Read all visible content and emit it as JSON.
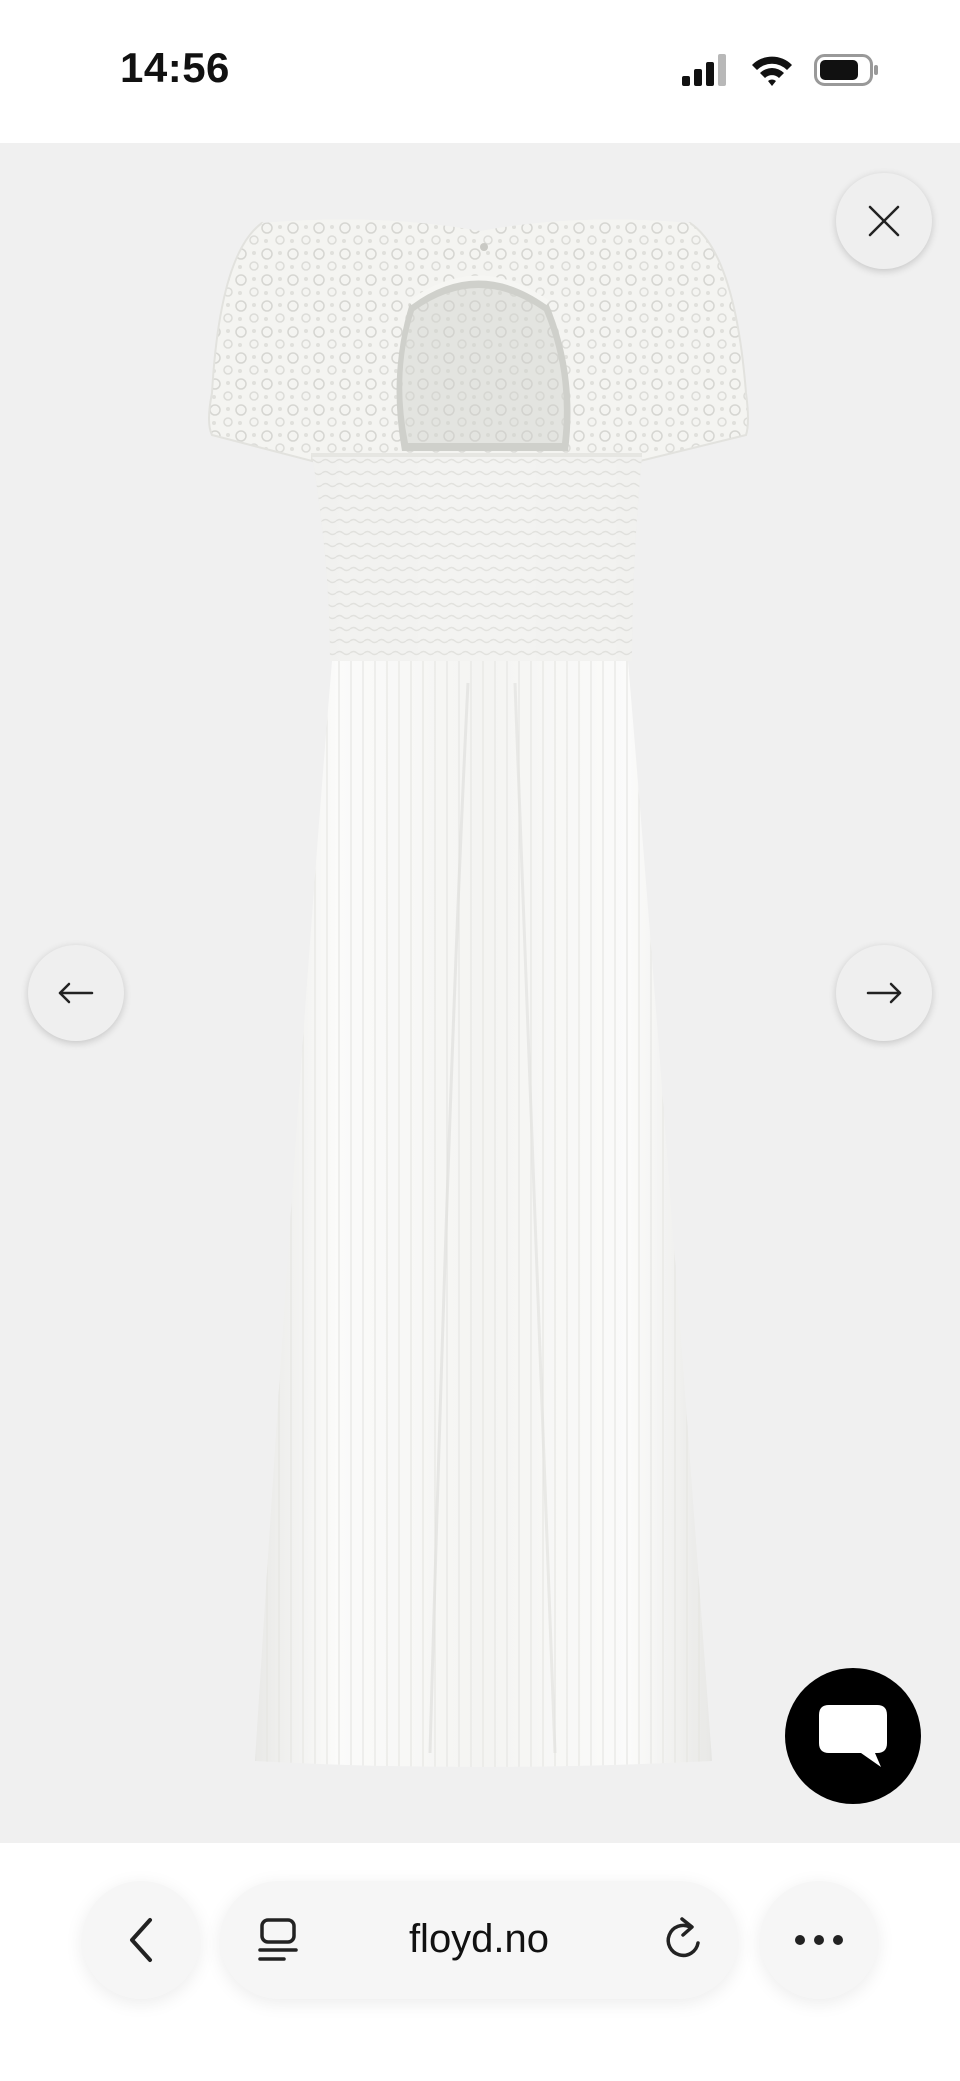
{
  "status_bar": {
    "time": "14:56",
    "icons": [
      "cellular-signal-icon",
      "wifi-icon",
      "battery-icon"
    ]
  },
  "viewer": {
    "image_subject": "white-maxi-dress-lace-back",
    "background_color": "#f0f0f0",
    "controls": {
      "close": "close-icon",
      "previous": "arrow-left-icon",
      "next": "arrow-right-icon"
    }
  },
  "chat": {
    "icon": "chat-bubble-icon",
    "color": "#000000"
  },
  "browser": {
    "url": "floyd.no",
    "icons": [
      "chevron-left-icon",
      "tabs-icon",
      "reload-icon",
      "more-icon"
    ]
  }
}
